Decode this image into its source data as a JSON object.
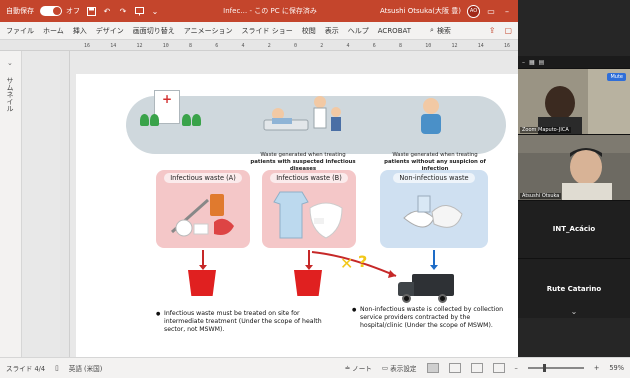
{
  "titlebar": {
    "autosave_label": "自動保存",
    "toggle_label": "オフ",
    "save_icon": "save-icon",
    "undo_icon": "undo-icon",
    "redo_icon": "redo-icon",
    "present_icon": "present-icon",
    "doc_status": "Infec… - この PC に保存済み",
    "user_name": "Atsushi Otsuka(大阪 豊)",
    "user_initials": "AO",
    "bg_color": "#c4452c"
  },
  "ribbon": {
    "tabs": [
      "ファイル",
      "ホーム",
      "挿入",
      "デザイン",
      "画面切り替え",
      "アニメーション",
      "スライド ショー",
      "校閲",
      "表示",
      "ヘルプ",
      "ACROBAT"
    ],
    "search_label": "検索"
  },
  "ruler_ticks": [
    "16",
    "14",
    "12",
    "10",
    "8",
    "6",
    "4",
    "2",
    "0",
    "2",
    "4",
    "6",
    "8",
    "10",
    "12",
    "14",
    "16"
  ],
  "left_pane": {
    "label": "サムネイル"
  },
  "slide": {
    "caption_patients_suspected_1": "Waste generated when treating ",
    "caption_patients_suspected_2": "patients with suspected infectious diseases",
    "caption_patients_none_1": "Waste generated when treating ",
    "caption_patients_none_2": "patients without any suspicion of infection",
    "panel_a_title": "Infectious waste (A)",
    "panel_b_title": "Infectious waste (B)",
    "panel_c_title": "Non-infectious waste",
    "bullet_left": "Infectious waste must be treated on site for intermediate treatment (Under the scope of health sector, not MSWM).",
    "bullet_right": "Non-infectious waste is collected by collection service providers contracted by the hospital/clinic (Under the scope of MSWM).",
    "x_mark": "✕",
    "q_mark": "?"
  },
  "statusbar": {
    "slide_counter": "スライド 4/4",
    "language": "英語 (米国)",
    "notes_label": "ノート",
    "display_settings_label": "表示設定",
    "zoom_percent": "59%",
    "zoom_fraction": 0.59
  },
  "video": {
    "mute_label": "Mute",
    "tiles": [
      {
        "name": "Zoom Maputo-JICA"
      },
      {
        "name": "Atsushi Otsuka"
      },
      {
        "title": "INT_Acácio"
      },
      {
        "title": "Rute Catarino"
      }
    ]
  }
}
